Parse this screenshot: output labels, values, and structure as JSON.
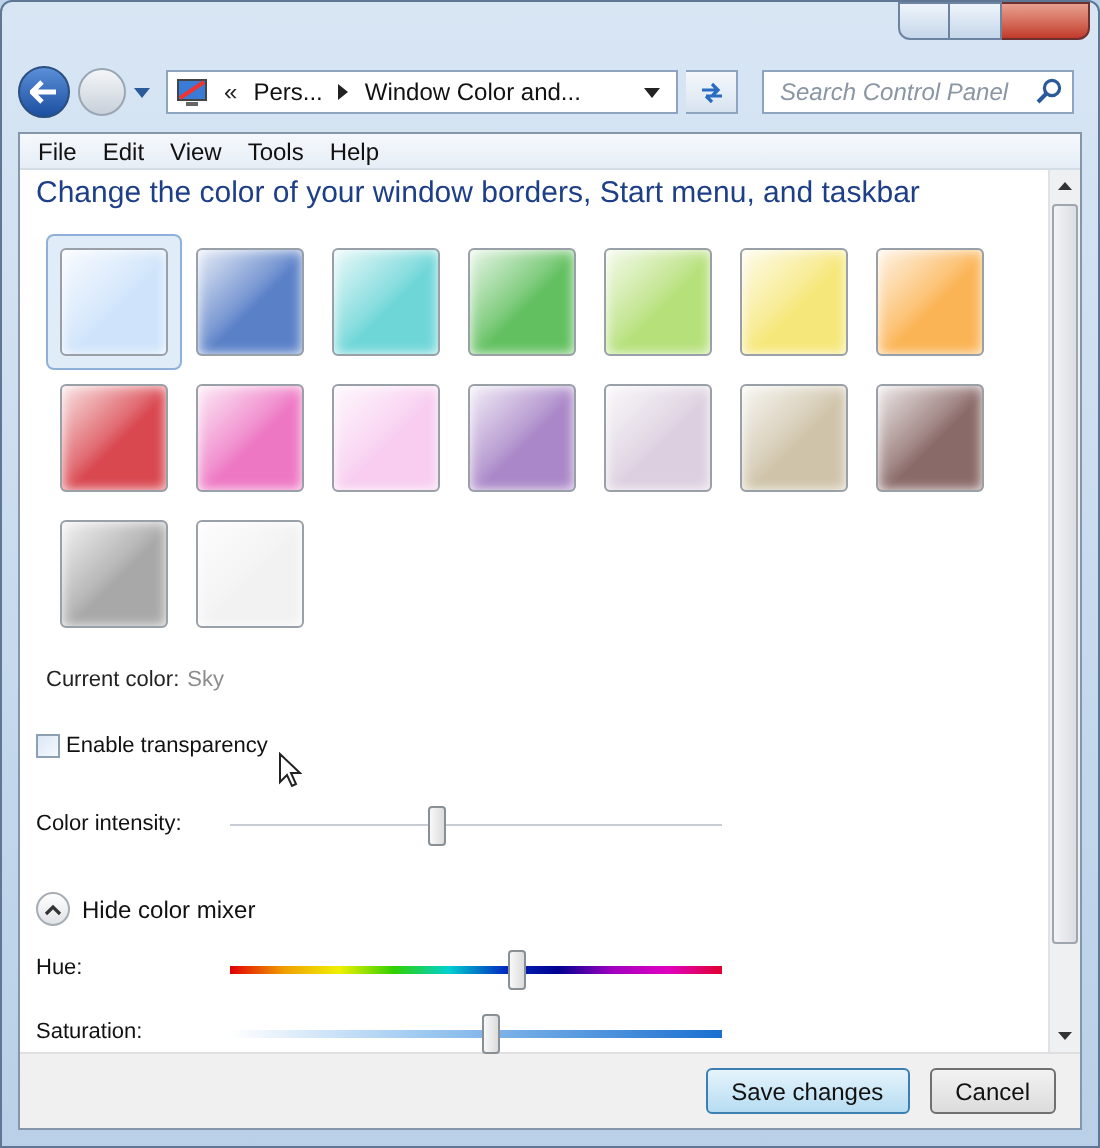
{
  "address_bar": {
    "overflow": "«",
    "crumbs": [
      "Pers...",
      "Window Color and..."
    ]
  },
  "search": {
    "placeholder": "Search Control Panel"
  },
  "menu": [
    "File",
    "Edit",
    "View",
    "Tools",
    "Help"
  ],
  "heading": "Change the color of your window borders, Start menu, and taskbar",
  "swatches": [
    {
      "color": "#cfe4fb",
      "selected": true
    },
    {
      "color": "#5a80c8",
      "selected": false
    },
    {
      "color": "#6fd6d8",
      "selected": false
    },
    {
      "color": "#62c060",
      "selected": false
    },
    {
      "color": "#b6e07a",
      "selected": false
    },
    {
      "color": "#f6e77a",
      "selected": false
    },
    {
      "color": "#fbb455",
      "selected": false
    },
    {
      "color": "#d9474f",
      "selected": false
    },
    {
      "color": "#ee77c4",
      "selected": false
    },
    {
      "color": "#f8cdf0",
      "selected": false
    },
    {
      "color": "#a987c8",
      "selected": false
    },
    {
      "color": "#dcd0e0",
      "selected": false
    },
    {
      "color": "#cfc4aa",
      "selected": false
    },
    {
      "color": "#8a6a68",
      "selected": false
    },
    {
      "color": "#a8a8a8",
      "selected": false
    },
    {
      "color": "#f2f2f2",
      "selected": false
    }
  ],
  "current_color": {
    "label": "Current color:",
    "value": "Sky"
  },
  "transparency": {
    "label": "Enable transparency",
    "checked": false
  },
  "intensity": {
    "label": "Color intensity:",
    "level": 0.42
  },
  "mixer": {
    "label": "Hide color mixer",
    "expanded": true
  },
  "sliders": [
    {
      "kind": "hue",
      "label": "Hue:",
      "level": 0.58
    },
    {
      "kind": "saturation",
      "label": "Saturation:",
      "level": 0.53
    }
  ],
  "buttons": [
    {
      "label": "Save changes",
      "default": true
    },
    {
      "label": "Cancel",
      "default": false
    }
  ]
}
